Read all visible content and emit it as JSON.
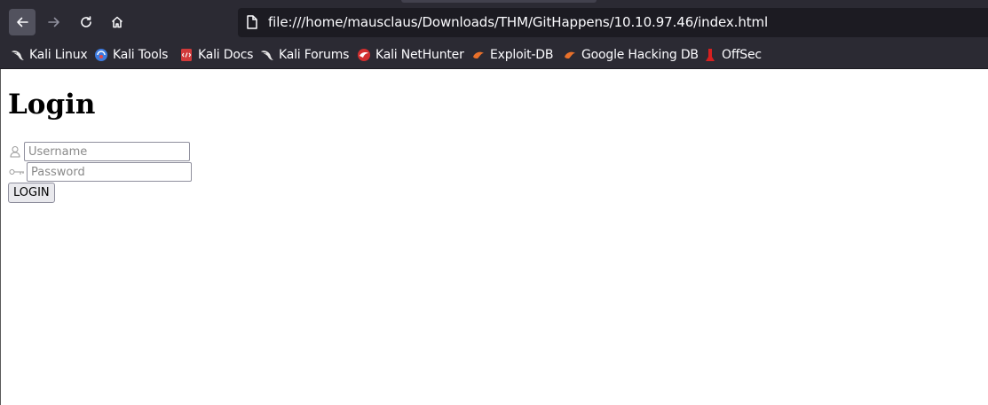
{
  "browser": {
    "url": "file:///home/mausclaus/Downloads/THM/GitHappens/10.10.97.46/index.html",
    "bookmarks": [
      {
        "label": "Kali Linux",
        "icon": "kali-dragon-icon"
      },
      {
        "label": "Kali Tools",
        "icon": "kali-tools-icon"
      },
      {
        "label": "Kali Docs",
        "icon": "kali-docs-icon"
      },
      {
        "label": "Kali Forums",
        "icon": "kali-dragon-icon"
      },
      {
        "label": "Kali NetHunter",
        "icon": "nethunter-icon"
      },
      {
        "label": "Exploit-DB",
        "icon": "exploit-db-icon"
      },
      {
        "label": "Google Hacking DB",
        "icon": "exploit-db-icon"
      },
      {
        "label": "OffSec",
        "icon": "offsec-icon"
      }
    ],
    "colors": {
      "toolbar": "#2b2a33",
      "urlbar": "#1c1b22",
      "text": "#fbfbfe"
    }
  },
  "page": {
    "title": "Login",
    "username_placeholder": "Username",
    "password_placeholder": "Password",
    "username_icon": "user-icon",
    "password_icon": "key-icon",
    "login_button": "LOGIN"
  }
}
